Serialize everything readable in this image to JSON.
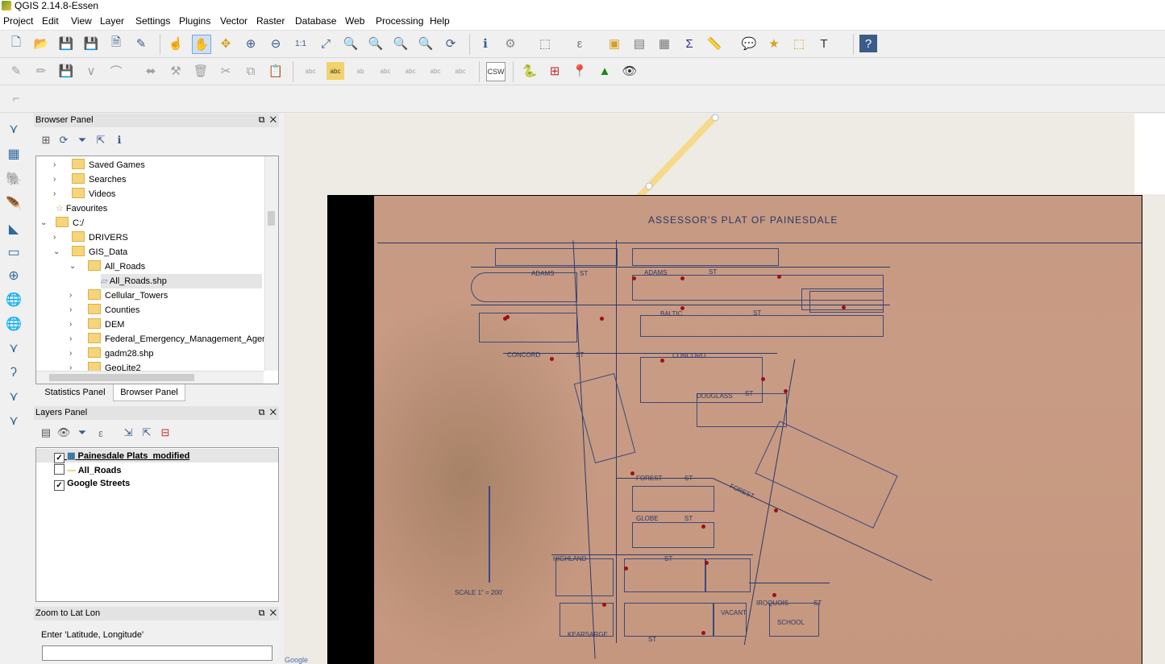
{
  "app": {
    "title": "QGIS 2.14.8-Essen"
  },
  "menu": [
    "Project",
    "Edit",
    "View",
    "Layer",
    "Settings",
    "Plugins",
    "Vector",
    "Raster",
    "Database",
    "Web",
    "Processing",
    "Help"
  ],
  "toolbar": {
    "csw_label": "CSW"
  },
  "browser_panel": {
    "title": "Browser Panel",
    "items": [
      {
        "label": "Saved Games"
      },
      {
        "label": "Searches"
      },
      {
        "label": "Videos"
      },
      {
        "label": "Favourites"
      },
      {
        "label": "C:/"
      },
      {
        "label": "DRIVERS"
      },
      {
        "label": "GIS_Data"
      },
      {
        "label": "All_Roads"
      },
      {
        "label": "All_Roads.shp"
      },
      {
        "label": "Cellular_Towers"
      },
      {
        "label": "Counties"
      },
      {
        "label": "DEM"
      },
      {
        "label": "Federal_Emergency_Management_Agenc"
      },
      {
        "label": "gadm28.shp"
      },
      {
        "label": "GeoLite2"
      }
    ],
    "tabs": [
      "Statistics Panel",
      "Browser Panel"
    ]
  },
  "layers_panel": {
    "title": "Layers Panel",
    "layers": [
      {
        "label": "Painesdale Plats_modified",
        "checked": true
      },
      {
        "label": "All_Roads",
        "checked": false
      },
      {
        "label": "Google Streets",
        "checked": true
      }
    ]
  },
  "zoom_panel": {
    "title": "Zoom to Lat Lon",
    "prompt": "Enter 'Latitude, Longitude'",
    "value": ""
  },
  "map": {
    "plat_title": "ASSESSOR'S PLAT OF PAINESDALE",
    "street_labels": [
      "ADAMS",
      "ST",
      "ADAMS",
      "ST",
      "BALTIC",
      "ST",
      "CONCORD",
      "ST",
      "CONCORD",
      "DOUGLASS",
      "ST",
      "FOREST",
      "ST",
      "GLOBE",
      "ST",
      "HIGHLAND",
      "ST",
      "IROQUOIS",
      "ST",
      "KEARSARGE",
      "ST",
      "VACANT",
      "SCHOOL",
      "FOREST"
    ],
    "scale_label": "SCALE 1\" = 200'",
    "attribution": "Google"
  }
}
